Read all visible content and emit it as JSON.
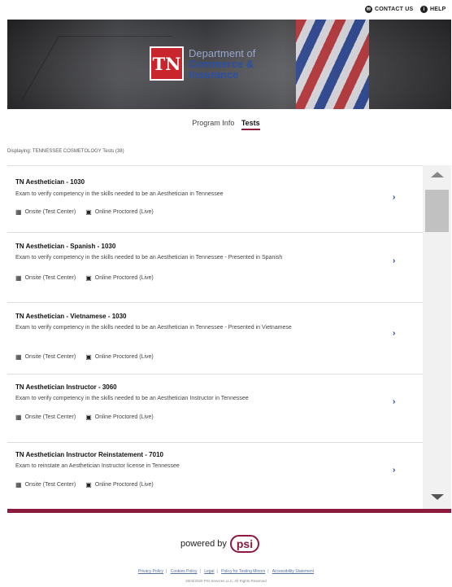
{
  "header": {
    "contact_label": "CONTACT US",
    "help_label": "HELP",
    "contact_icon": "chat-icon",
    "help_icon": "info-icon"
  },
  "hero": {
    "logo_text": "TN",
    "dept_line1": "Department of",
    "dept_line2": "Commerce &",
    "dept_line3": "Insurance"
  },
  "tabs": [
    {
      "label": "Program Info",
      "active": false
    },
    {
      "label": "Tests",
      "active": true
    }
  ],
  "displaying_text": "Displaying: TENNESSEE COSMETOLOGY Tests (38)",
  "tests": [
    {
      "title": "TN Aesthetician - 1030",
      "description": "Exam to verify competency in the skills needed to be an Aesthetician in Tennessee",
      "onsite": "Onsite (Test Center)",
      "online": "Online Proctored (Live)"
    },
    {
      "title": "TN Aesthetician - Spanish - 1030",
      "description": "Exam to verify competency in the skills needed to be an Aesthetician in Tennessee - Presented in Spanish",
      "onsite": "Onsite (Test Center)",
      "online": "Online Proctored (Live)"
    },
    {
      "title": "TN Aesthetician - Vietnamese - 1030",
      "description": "Exam to verify competency in the skills needed to be an Aesthetician in Tennessee - Presented in Vietnamese",
      "onsite": "Onsite (Test Center)",
      "online": "Online Proctored (Live)"
    },
    {
      "title": "TN Aesthetician Instructor - 3060",
      "description": "Exam to verify competency in the skills needed to be an Aesthetician Instructor in Tennessee",
      "onsite": "Onsite (Test Center)",
      "online": "Online Proctored (Live)"
    },
    {
      "title": "TN Aesthetician Instructor Reinstatement - 7010",
      "description": "Exam to reinstate an Aesthetician Instructor license in Tennessee",
      "onsite": "Onsite (Test Center)",
      "online": "Online Proctored (Live)"
    }
  ],
  "footer": {
    "powered_by": "powered by",
    "psi": "psi",
    "links": [
      "Privacy Policy",
      "Cookies Policy",
      "Legal",
      "Policy for Testing Minors",
      "Accessibility Statement"
    ],
    "copyright": "2003/2020 PSI Services LLC, All Rights Reserved"
  },
  "colors": {
    "accent": "#8b1a3c",
    "logo_red": "#c8262c",
    "link_blue": "#1a3a8a"
  }
}
